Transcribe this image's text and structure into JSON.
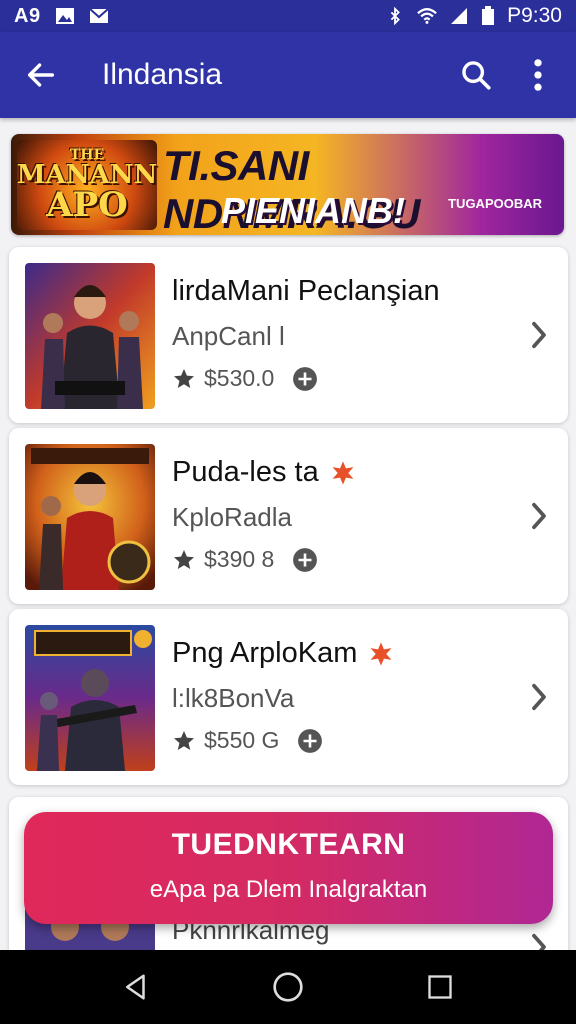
{
  "status_bar": {
    "left_time": "A9",
    "right_time": "P9:30",
    "icons": [
      "image-icon",
      "mail-icon",
      "bluetooth-icon",
      "wifi-icon",
      "signal-icon",
      "battery-icon"
    ]
  },
  "app_bar": {
    "title": "Ilndansia",
    "icons": [
      "back-arrow-icon",
      "search-icon",
      "more-vert-icon"
    ]
  },
  "banner": {
    "logo_lines": [
      "THE",
      "MANANN",
      "APO"
    ],
    "headline": "TI.SANI NDNMRA.GU",
    "subheadline": "PIENIANB!",
    "tag": "TUGAPOOBAR"
  },
  "items": [
    {
      "name": "lirdaMani Peclanşian",
      "developer": "AnpCanl l",
      "price": "$530.0",
      "badge": ""
    },
    {
      "name": "Puda-les ta",
      "developer": "KploRadla",
      "price": "$390 8",
      "badge": "star-badge"
    },
    {
      "name": "Png ArploKam",
      "developer": "l:lk8BonVa",
      "price": "$550 G",
      "badge": "star-badge"
    }
  ],
  "partial_item": {
    "name": "Pknnrlkalmeg"
  },
  "cta": {
    "title": "TUEDNKTEARN",
    "subtitle": "eApa pa Dlem Inalgraktan"
  },
  "colors": {
    "app_bar": "#2f33a6",
    "status_bar": "#2a2f9a",
    "cta_start": "#e0285a",
    "cta_end": "#b02794",
    "badge": "#e8502a"
  }
}
